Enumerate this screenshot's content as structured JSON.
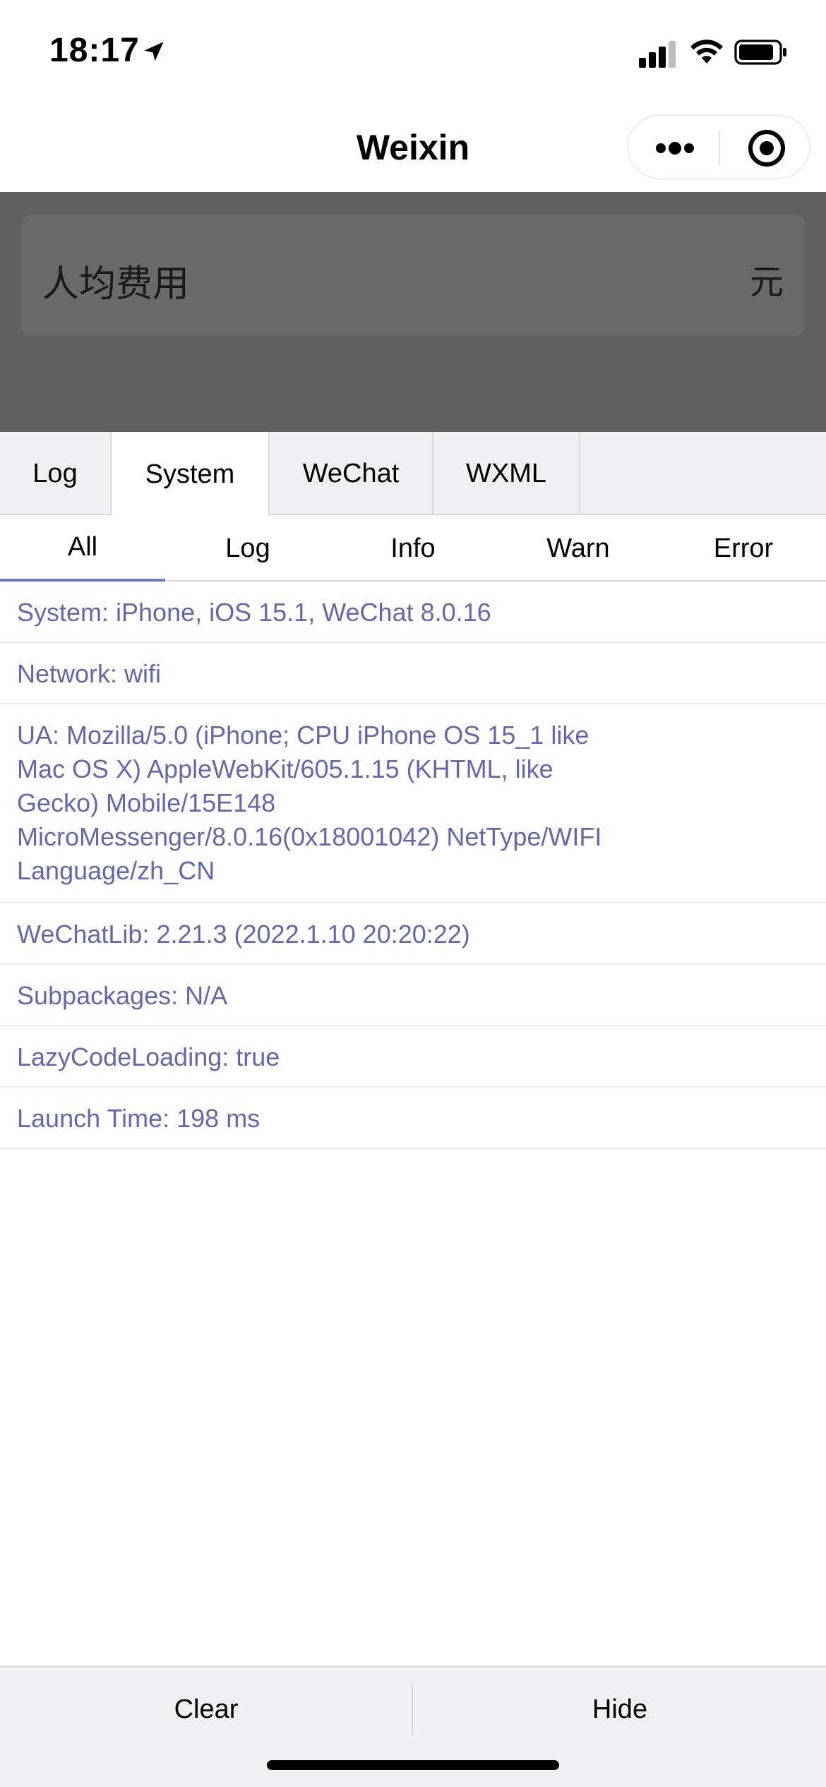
{
  "status_bar": {
    "time": "18:17"
  },
  "nav": {
    "title": "Weixin"
  },
  "content": {
    "cost_label": "人均费用",
    "cost_unit": "元"
  },
  "console": {
    "tabs": [
      {
        "label": "Log"
      },
      {
        "label": "System",
        "active": true
      },
      {
        "label": "WeChat"
      },
      {
        "label": "WXML"
      }
    ],
    "subtabs": [
      {
        "label": "All",
        "active": true
      },
      {
        "label": "Log"
      },
      {
        "label": "Info"
      },
      {
        "label": "Warn"
      },
      {
        "label": "Error"
      }
    ],
    "entries": [
      {
        "lines": [
          "System: iPhone, iOS 15.1, WeChat 8.0.16"
        ]
      },
      {
        "lines": [
          "Network: wifi"
        ]
      },
      {
        "lines": [
          "UA: Mozilla/5.0 (iPhone; CPU iPhone OS 15_1 like",
          "Mac OS X) AppleWebKit/605.1.15 (KHTML, like",
          "Gecko) Mobile/15E148",
          "MicroMessenger/8.0.16(0x18001042) NetType/WIFI",
          "Language/zh_CN"
        ]
      },
      {
        "lines": [
          "WeChatLib: 2.21.3 (2022.1.10 20:20:22)"
        ]
      },
      {
        "lines": [
          "Subpackages: N/A"
        ]
      },
      {
        "lines": [
          "LazyCodeLoading: true"
        ]
      },
      {
        "lines": [
          "Launch Time: 198 ms"
        ]
      }
    ],
    "footer": {
      "clear_label": "Clear",
      "hide_label": "Hide"
    }
  },
  "colors": {
    "log_text": "#6668a6",
    "tab_bg": "#efeff4",
    "mask": "#5f6062",
    "active_underline": "#6c7db3"
  }
}
